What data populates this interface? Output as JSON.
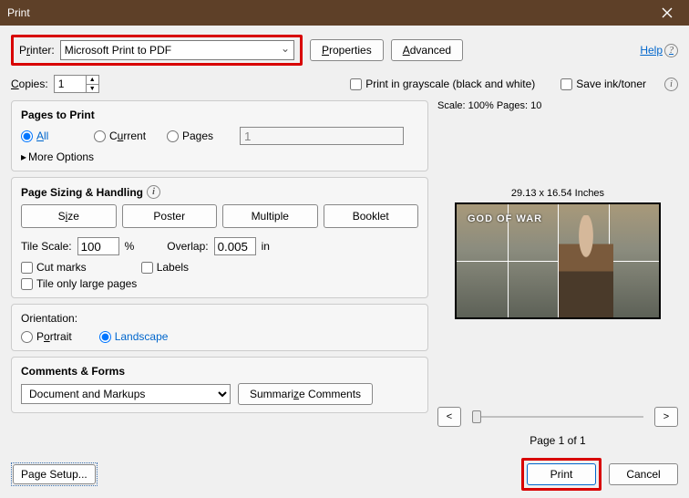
{
  "titlebar": {
    "title": "Print"
  },
  "printer": {
    "label": "Printer:",
    "selected": "Microsoft Print to PDF"
  },
  "buttons": {
    "properties": "Properties",
    "advanced": "Advanced",
    "help": "Help",
    "page_setup": "Page Setup...",
    "print": "Print",
    "cancel": "Cancel",
    "summarize": "Summarize Comments"
  },
  "copies": {
    "label": "Copies:",
    "value": "1"
  },
  "options": {
    "grayscale": "Print in grayscale (black and white)",
    "save_ink": "Save ink/toner"
  },
  "pages_section": {
    "title": "Pages to Print",
    "all": "All",
    "current": "Current",
    "pages": "Pages",
    "pages_value": "1",
    "more": "More Options"
  },
  "sizing": {
    "title": "Page Sizing & Handling",
    "size": "Size",
    "poster": "Poster",
    "multiple": "Multiple",
    "booklet": "Booklet",
    "tile_scale_label": "Tile Scale:",
    "tile_scale_value": "100",
    "percent": "%",
    "overlap_label": "Overlap:",
    "overlap_value": "0.005",
    "overlap_unit": "in",
    "cut_marks": "Cut marks",
    "labels": "Labels",
    "tile_large": "Tile only large pages"
  },
  "orientation": {
    "title": "Orientation:",
    "portrait": "Portrait",
    "landscape": "Landscape"
  },
  "comments": {
    "title": "Comments & Forms",
    "selected": "Document and Markups"
  },
  "preview": {
    "scale_line": "Scale: 100% Pages: 10",
    "dims": "29.13 x 16.54 Inches",
    "logo": "GOD OF WAR",
    "page_label": "Page 1 of 1",
    "prev": "<",
    "next": ">"
  }
}
